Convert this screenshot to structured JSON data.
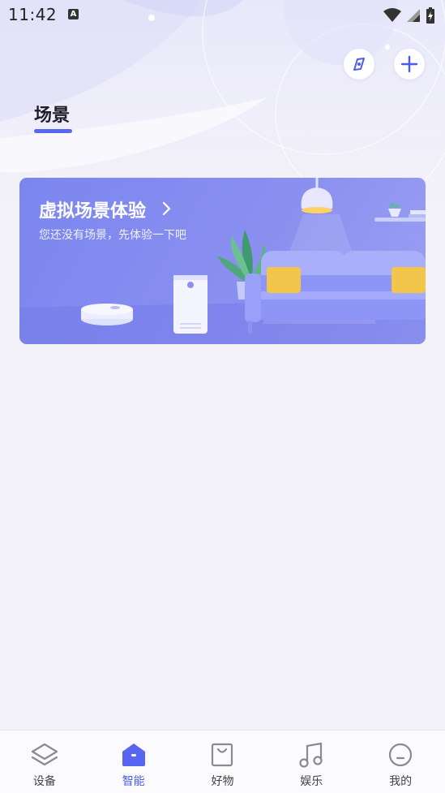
{
  "status_bar": {
    "time": "11:42",
    "notification_letter": "A"
  },
  "header": {
    "title": "场景",
    "compass_icon": "compass-icon",
    "add_icon": "plus-icon"
  },
  "banner": {
    "title": "虚拟场景体验",
    "subtitle": "您还没有场景，先体验一下吧",
    "arrow_icon": "chevron-right-icon"
  },
  "tabbar": {
    "active_index": 1,
    "tabs": [
      {
        "label": "设备",
        "icon": "layers-icon"
      },
      {
        "label": "智能",
        "icon": "home-icon"
      },
      {
        "label": "好物",
        "icon": "bag-icon"
      },
      {
        "label": "娱乐",
        "icon": "music-note-icon"
      },
      {
        "label": "我的",
        "icon": "smile-face-icon"
      }
    ]
  },
  "colors": {
    "accent": "#4a5cf0",
    "banner_start": "#7b86ef",
    "background": "#f3f2f8"
  }
}
